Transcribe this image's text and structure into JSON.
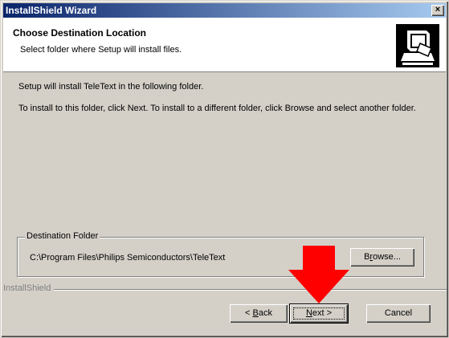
{
  "window": {
    "title": "InstallShield Wizard",
    "close_glyph": "×"
  },
  "header": {
    "title": "Choose Destination Location",
    "subtitle": "Select folder where Setup will install files.",
    "icon": "computer-install-icon"
  },
  "body": {
    "line1": "Setup will install TeleText in the following folder.",
    "line2": "To install to this folder, click Next. To install to a different folder, click Browse and select another folder."
  },
  "destination": {
    "legend": "Destination Folder",
    "path": "C:\\Program Files\\Philips Semiconductors\\TeleText",
    "browse_pre": "B",
    "browse_mnemonic": "r",
    "browse_post": "owse..."
  },
  "footer": {
    "brand": "InstallShield",
    "back_pre": "< ",
    "back_mnemonic": "B",
    "back_post": "ack",
    "next_mnemonic": "N",
    "next_post": "ext >",
    "cancel": "Cancel"
  },
  "annotation": {
    "arrow_color": "#ff0000",
    "icon": "red-down-arrow"
  }
}
